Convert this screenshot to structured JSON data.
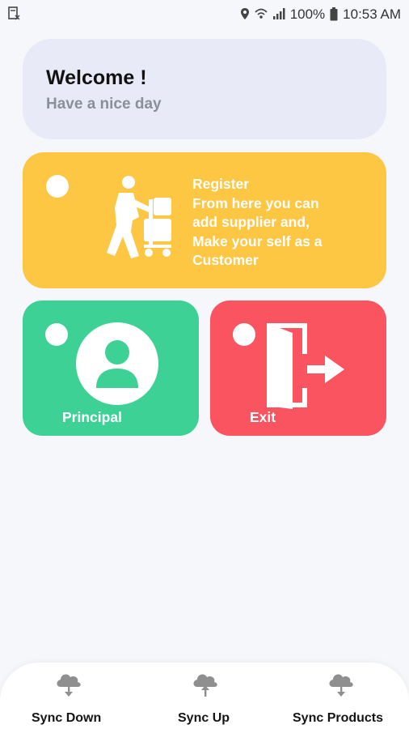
{
  "status_bar": {
    "battery_percent": "100%",
    "time": "10:53 AM",
    "icons": [
      "notification-icon",
      "location-icon",
      "wifi-icon",
      "signal-icon",
      "battery-icon"
    ]
  },
  "welcome": {
    "title": "Welcome !",
    "subtitle": "Have a nice day"
  },
  "register": {
    "lines": [
      "Register",
      "From here you can",
      "add supplier and,",
      "Make your self as a",
      "Customer"
    ]
  },
  "tiles": {
    "principal_label": "Principal",
    "exit_label": "Exit"
  },
  "bottom_nav": {
    "sync_down": "Sync Down",
    "sync_up": "Sync Up",
    "sync_products": "Sync Products"
  },
  "colors": {
    "welcome_bg": "#e8ebf7",
    "register_bg": "#fdc643",
    "principal_bg": "#3ed196",
    "exit_bg": "#fa5461",
    "page_bg": "#f6f7fb"
  }
}
